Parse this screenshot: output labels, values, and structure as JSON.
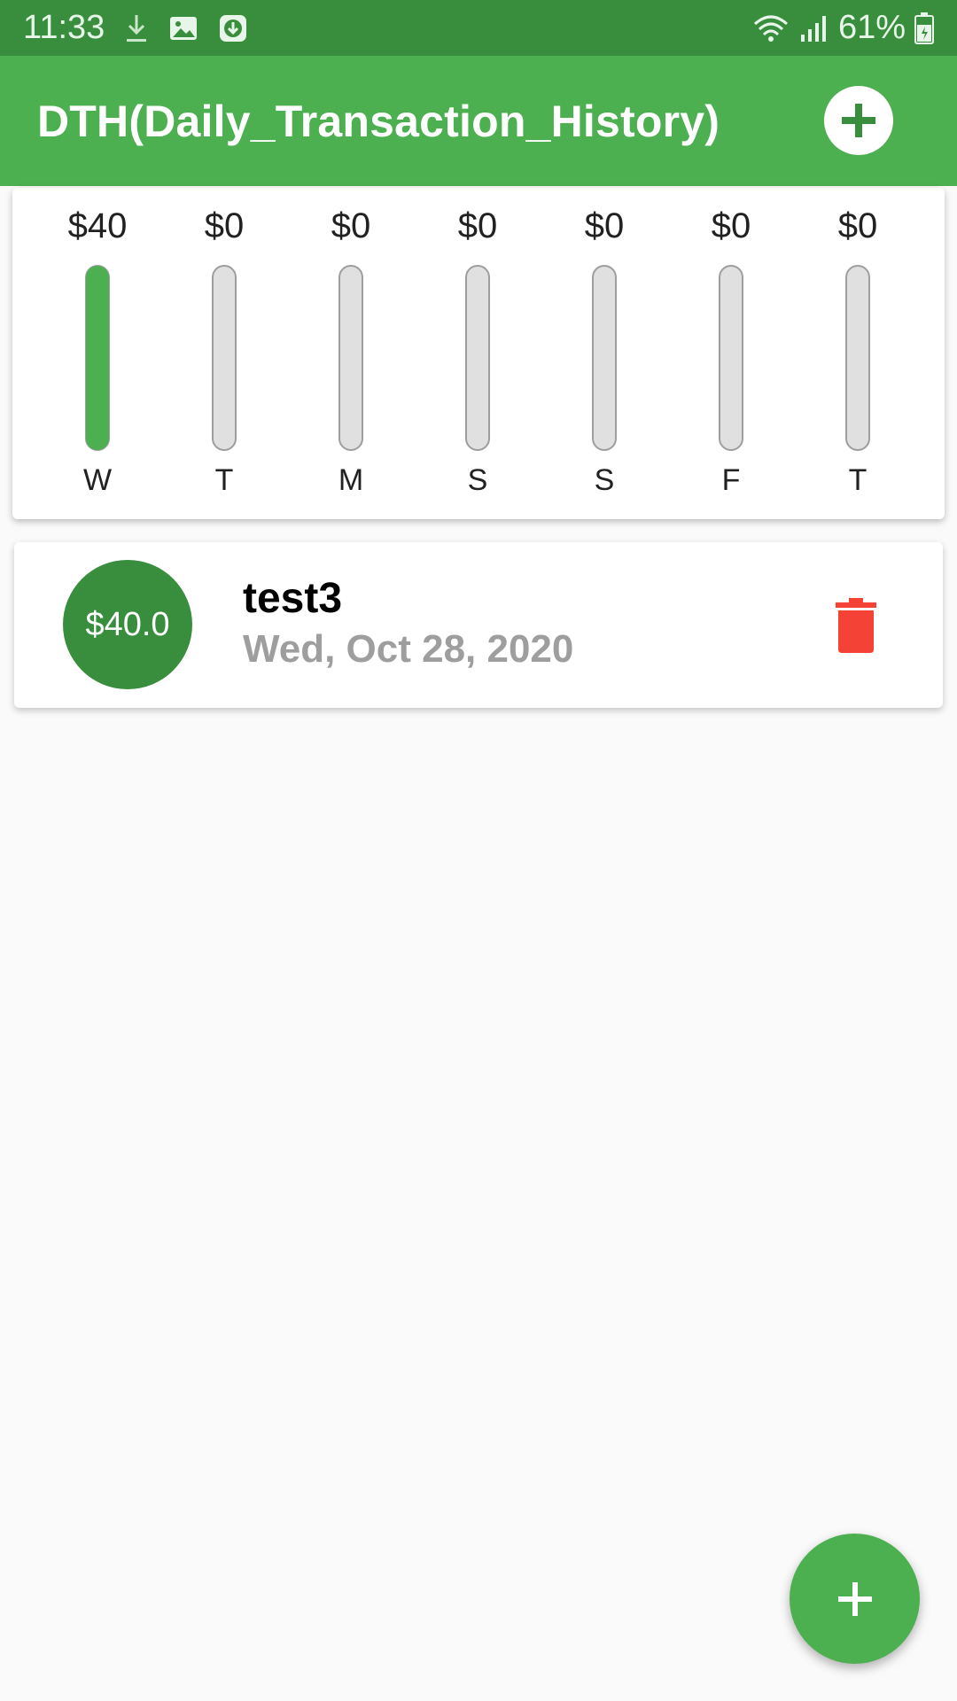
{
  "status_bar": {
    "time": "11:33",
    "battery": "61%",
    "icons": [
      "download-icon",
      "image-icon",
      "download-circle-icon",
      "wifi-icon",
      "signal-icon",
      "battery-icon"
    ]
  },
  "app_bar": {
    "title": "DTH(Daily_Transaction_History)",
    "add_icon": "plus-circle-icon"
  },
  "chart_data": {
    "type": "bar",
    "categories": [
      "W",
      "T",
      "M",
      "S",
      "S",
      "F",
      "T"
    ],
    "values": [
      40,
      0,
      0,
      0,
      0,
      0,
      0
    ],
    "value_labels": [
      "$40",
      "$0",
      "$0",
      "$0",
      "$0",
      "$0",
      "$0"
    ],
    "ylim": [
      0,
      40
    ],
    "colors": {
      "fill": "#4caf50",
      "track": "#e0e0e0",
      "track_border": "#9e9e9e"
    }
  },
  "transactions": [
    {
      "amount": "$40.0",
      "title": "test3",
      "date": "Wed, Oct 28, 2020",
      "delete_icon": "trash-icon"
    }
  ],
  "fab": {
    "icon": "plus-icon"
  },
  "colors": {
    "primary": "#4caf50",
    "primary_dark": "#388e3c",
    "delete": "#f44336",
    "muted_text": "#9e9e9e"
  }
}
